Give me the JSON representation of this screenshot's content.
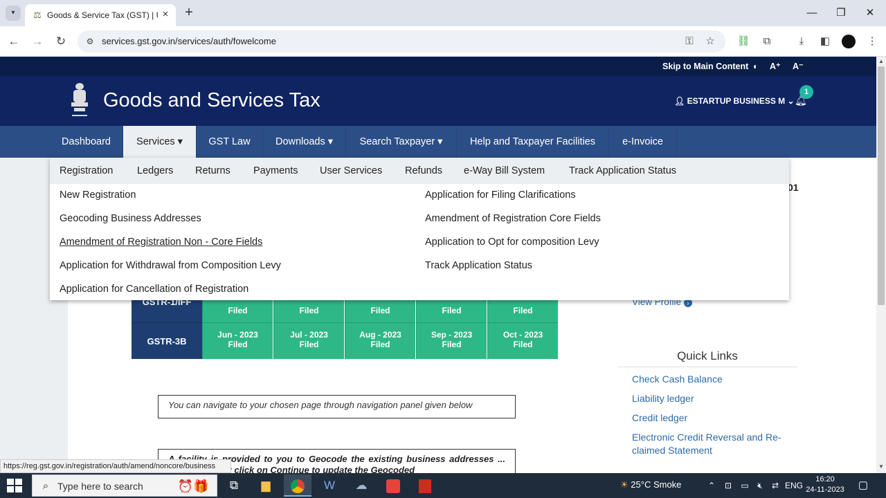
{
  "browser": {
    "tab_title": "Goods & Service Tax (GST) | User Dashboard",
    "new_tab_label": "+",
    "url": "services.gst.gov.in/services/auth/fowelcome",
    "status_url": "https://reg.gst.gov.in/registration/auth/amend/noncore/business"
  },
  "util_bar": {
    "skip": "Skip to Main Content",
    "font_increase": "A⁺",
    "font_decrease": "A⁻"
  },
  "header": {
    "title": "Goods and Services Tax",
    "user": "ESTARTUP BUSINESS M",
    "notification_count": "1"
  },
  "main_nav": [
    {
      "label": "Dashboard"
    },
    {
      "label": "Services ▾"
    },
    {
      "label": "GST Law"
    },
    {
      "label": "Downloads ▾"
    },
    {
      "label": "Search Taxpayer ▾"
    },
    {
      "label": "Help and Taxpayer Facilities"
    },
    {
      "label": "e-Invoice"
    }
  ],
  "services_menu": {
    "categories": [
      "Registration",
      "Ledgers",
      "Returns",
      "Payments",
      "User Services",
      "Refunds",
      "e-Way Bill System",
      "Track Application Status"
    ],
    "left_items": [
      "New Registration",
      "Geocoding Business Addresses",
      "Amendment of Registration Non - Core Fields",
      "Application for Withdrawal from Composition Levy",
      "Application for Cancellation of Registration"
    ],
    "right_items": [
      "Application for Filing Clarifications",
      "Amendment of Registration Core Fields",
      "Application to Opt for composition Levy",
      "Track Application Status"
    ]
  },
  "return_table": {
    "rows": [
      {
        "label": "GSTR-1/IFF",
        "cells": [
          {
            "status": "Filed"
          },
          {
            "status": "Filed"
          },
          {
            "status": "Filed"
          },
          {
            "status": "Filed"
          },
          {
            "status": "Filed"
          }
        ]
      },
      {
        "label": "GSTR-3B",
        "cells": [
          {
            "month": "Jun - 2023",
            "status": "Filed"
          },
          {
            "month": "Jul - 2023",
            "status": "Filed"
          },
          {
            "month": "Aug - 2023",
            "status": "Filed"
          },
          {
            "month": "Sep - 2023",
            "status": "Filed"
          },
          {
            "month": "Oct - 2023",
            "status": "Filed"
          }
        ]
      }
    ]
  },
  "profile": {
    "gstin_fragment": "01",
    "view_profile": "View Profile"
  },
  "quick_links": {
    "title": "Quick Links",
    "items": [
      "Check Cash Balance",
      "Liability ledger",
      "Credit ledger",
      "Electronic Credit Reversal and Re-claimed Statement"
    ]
  },
  "notes": {
    "navigate": "You can navigate to your chosen page through navigation panel given below",
    "geocode": "A facility is provided to you to Geocode the existing business addresses ... system. Kindly click on Continue to update the Geocoded"
  },
  "taskbar": {
    "search_placeholder": "Type here to search",
    "weather": "25°C  Smoke",
    "language": "ENG",
    "time": "16:20",
    "date": "24-11-2023"
  },
  "colors": {
    "header_bg": "#0f2461",
    "nav_bg": "#2c4e86",
    "filed_green": "#2eb888",
    "link_blue": "#2c6aa8"
  }
}
